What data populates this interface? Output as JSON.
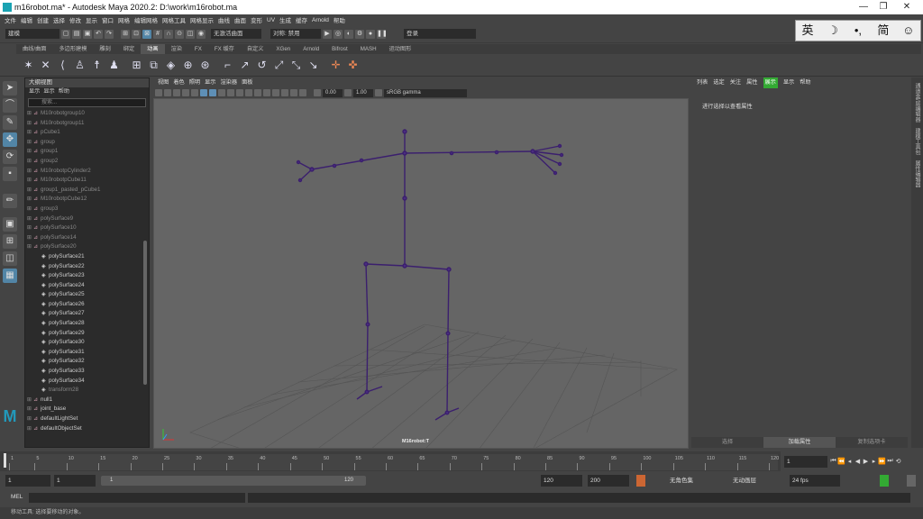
{
  "window": {
    "title": "m16robot.ma* - Autodesk Maya 2020.2: D:\\work\\m16robot.ma"
  },
  "menubar": [
    "文件",
    "编辑",
    "创建",
    "选择",
    "修改",
    "显示",
    "窗口",
    "网格",
    "编辑网格",
    "网格工具",
    "网格显示",
    "曲线",
    "曲面",
    "变形",
    "UV",
    "生成",
    "缓存",
    "Arnold",
    "帮助"
  ],
  "statusline": {
    "mode": "建模",
    "snap_field": "无激活曲面",
    "symmetry": "对称: 禁用",
    "login": "登录"
  },
  "ime": {
    "lang": "英",
    "moon": "☽",
    "punct": "•,",
    "simp": "简",
    "smile": "☺",
    "gear": "⚙"
  },
  "shelf_tabs": {
    "active_index": 4,
    "labels": [
      "曲线/曲面",
      "多边形建模",
      "雕刻",
      "绑定",
      "动画",
      "渲染",
      "FX",
      "FX 缓存",
      "自定义",
      "XGen",
      "Arnold",
      "Bifrost",
      "MASH",
      "运动图形"
    ]
  },
  "outliner": {
    "title": "大纲视图",
    "menu": [
      "显示",
      "显示",
      "帮助"
    ],
    "search_placeholder": "搜索...",
    "items": [
      {
        "label": "M10robotgroup10",
        "dim": true,
        "child": false
      },
      {
        "label": "M10robotgroup11",
        "dim": true,
        "child": false
      },
      {
        "label": "pCube1",
        "dim": true,
        "child": false
      },
      {
        "label": "group",
        "dim": true,
        "child": false
      },
      {
        "label": "group1",
        "dim": true,
        "child": false
      },
      {
        "label": "group2",
        "dim": true,
        "child": false
      },
      {
        "label": "M10robotpCylinder2",
        "dim": true,
        "child": false
      },
      {
        "label": "M10robotpCube11",
        "dim": true,
        "child": false
      },
      {
        "label": "group1_pasted_pCube1",
        "dim": true,
        "child": false
      },
      {
        "label": "M10robotpCube12",
        "dim": true,
        "child": false
      },
      {
        "label": "group3",
        "dim": true,
        "child": false
      },
      {
        "label": "polySurface9",
        "dim": true,
        "child": false
      },
      {
        "label": "polySurface10",
        "dim": true,
        "child": false
      },
      {
        "label": "polySurface14",
        "dim": true,
        "child": false
      },
      {
        "label": "polySurface20",
        "dim": true,
        "child": false
      },
      {
        "label": "polySurface21",
        "dim": false,
        "child": true
      },
      {
        "label": "polySurface22",
        "dim": false,
        "child": true
      },
      {
        "label": "polySurface23",
        "dim": false,
        "child": true
      },
      {
        "label": "polySurface24",
        "dim": false,
        "child": true
      },
      {
        "label": "polySurface25",
        "dim": false,
        "child": true
      },
      {
        "label": "polySurface26",
        "dim": false,
        "child": true
      },
      {
        "label": "polySurface27",
        "dim": false,
        "child": true
      },
      {
        "label": "polySurface28",
        "dim": false,
        "child": true
      },
      {
        "label": "polySurface29",
        "dim": false,
        "child": true
      },
      {
        "label": "polySurface30",
        "dim": false,
        "child": true
      },
      {
        "label": "polySurface31",
        "dim": false,
        "child": true
      },
      {
        "label": "polySurface32",
        "dim": false,
        "child": true
      },
      {
        "label": "polySurface33",
        "dim": false,
        "child": true
      },
      {
        "label": "polySurface34",
        "dim": false,
        "child": true
      },
      {
        "label": "transform28",
        "dim": true,
        "child": true
      },
      {
        "label": "null1",
        "dim": false,
        "child": false
      },
      {
        "label": "joint_base",
        "dim": false,
        "child": false
      },
      {
        "label": "defaultLightSet",
        "dim": false,
        "child": false
      },
      {
        "label": "defaultObjectSet",
        "dim": false,
        "child": false
      }
    ]
  },
  "viewport": {
    "menu": [
      "视图",
      "着色",
      "照明",
      "显示",
      "渲染器",
      "面板"
    ],
    "exposure": "0.00",
    "gamma": "1.00",
    "colorspace": "sRGB gamma",
    "camera_label": "M16robot:T"
  },
  "attribute_editor": {
    "tabs": [
      "列表",
      "选定",
      "关注",
      "属性",
      "展示",
      "显示",
      "帮助"
    ],
    "highlight_index": 4,
    "message": "进行选择以查看属性",
    "bottom": [
      "选择",
      "加载属性",
      "复制选项卡"
    ]
  },
  "side_tabs": [
    "通道盒/层编辑器",
    "建模工具包",
    "属性编辑器"
  ],
  "timeslider": {
    "ticks": [
      1,
      5,
      10,
      15,
      20,
      25,
      30,
      35,
      40,
      45,
      50,
      55,
      60,
      65,
      70,
      75,
      80,
      85,
      90,
      95,
      100,
      105,
      110,
      115,
      120
    ],
    "current_frame": "1"
  },
  "range": {
    "start": "1",
    "start2": "1",
    "bar_start": "1",
    "bar_end": "120",
    "end": "120",
    "end2": "200",
    "anim_layer": "无角色集",
    "anim_layer2": "无动画层",
    "fps": "24 fps"
  },
  "mel": {
    "label": "MEL"
  },
  "help_line": "移动工具: 选择要移动的对象。"
}
